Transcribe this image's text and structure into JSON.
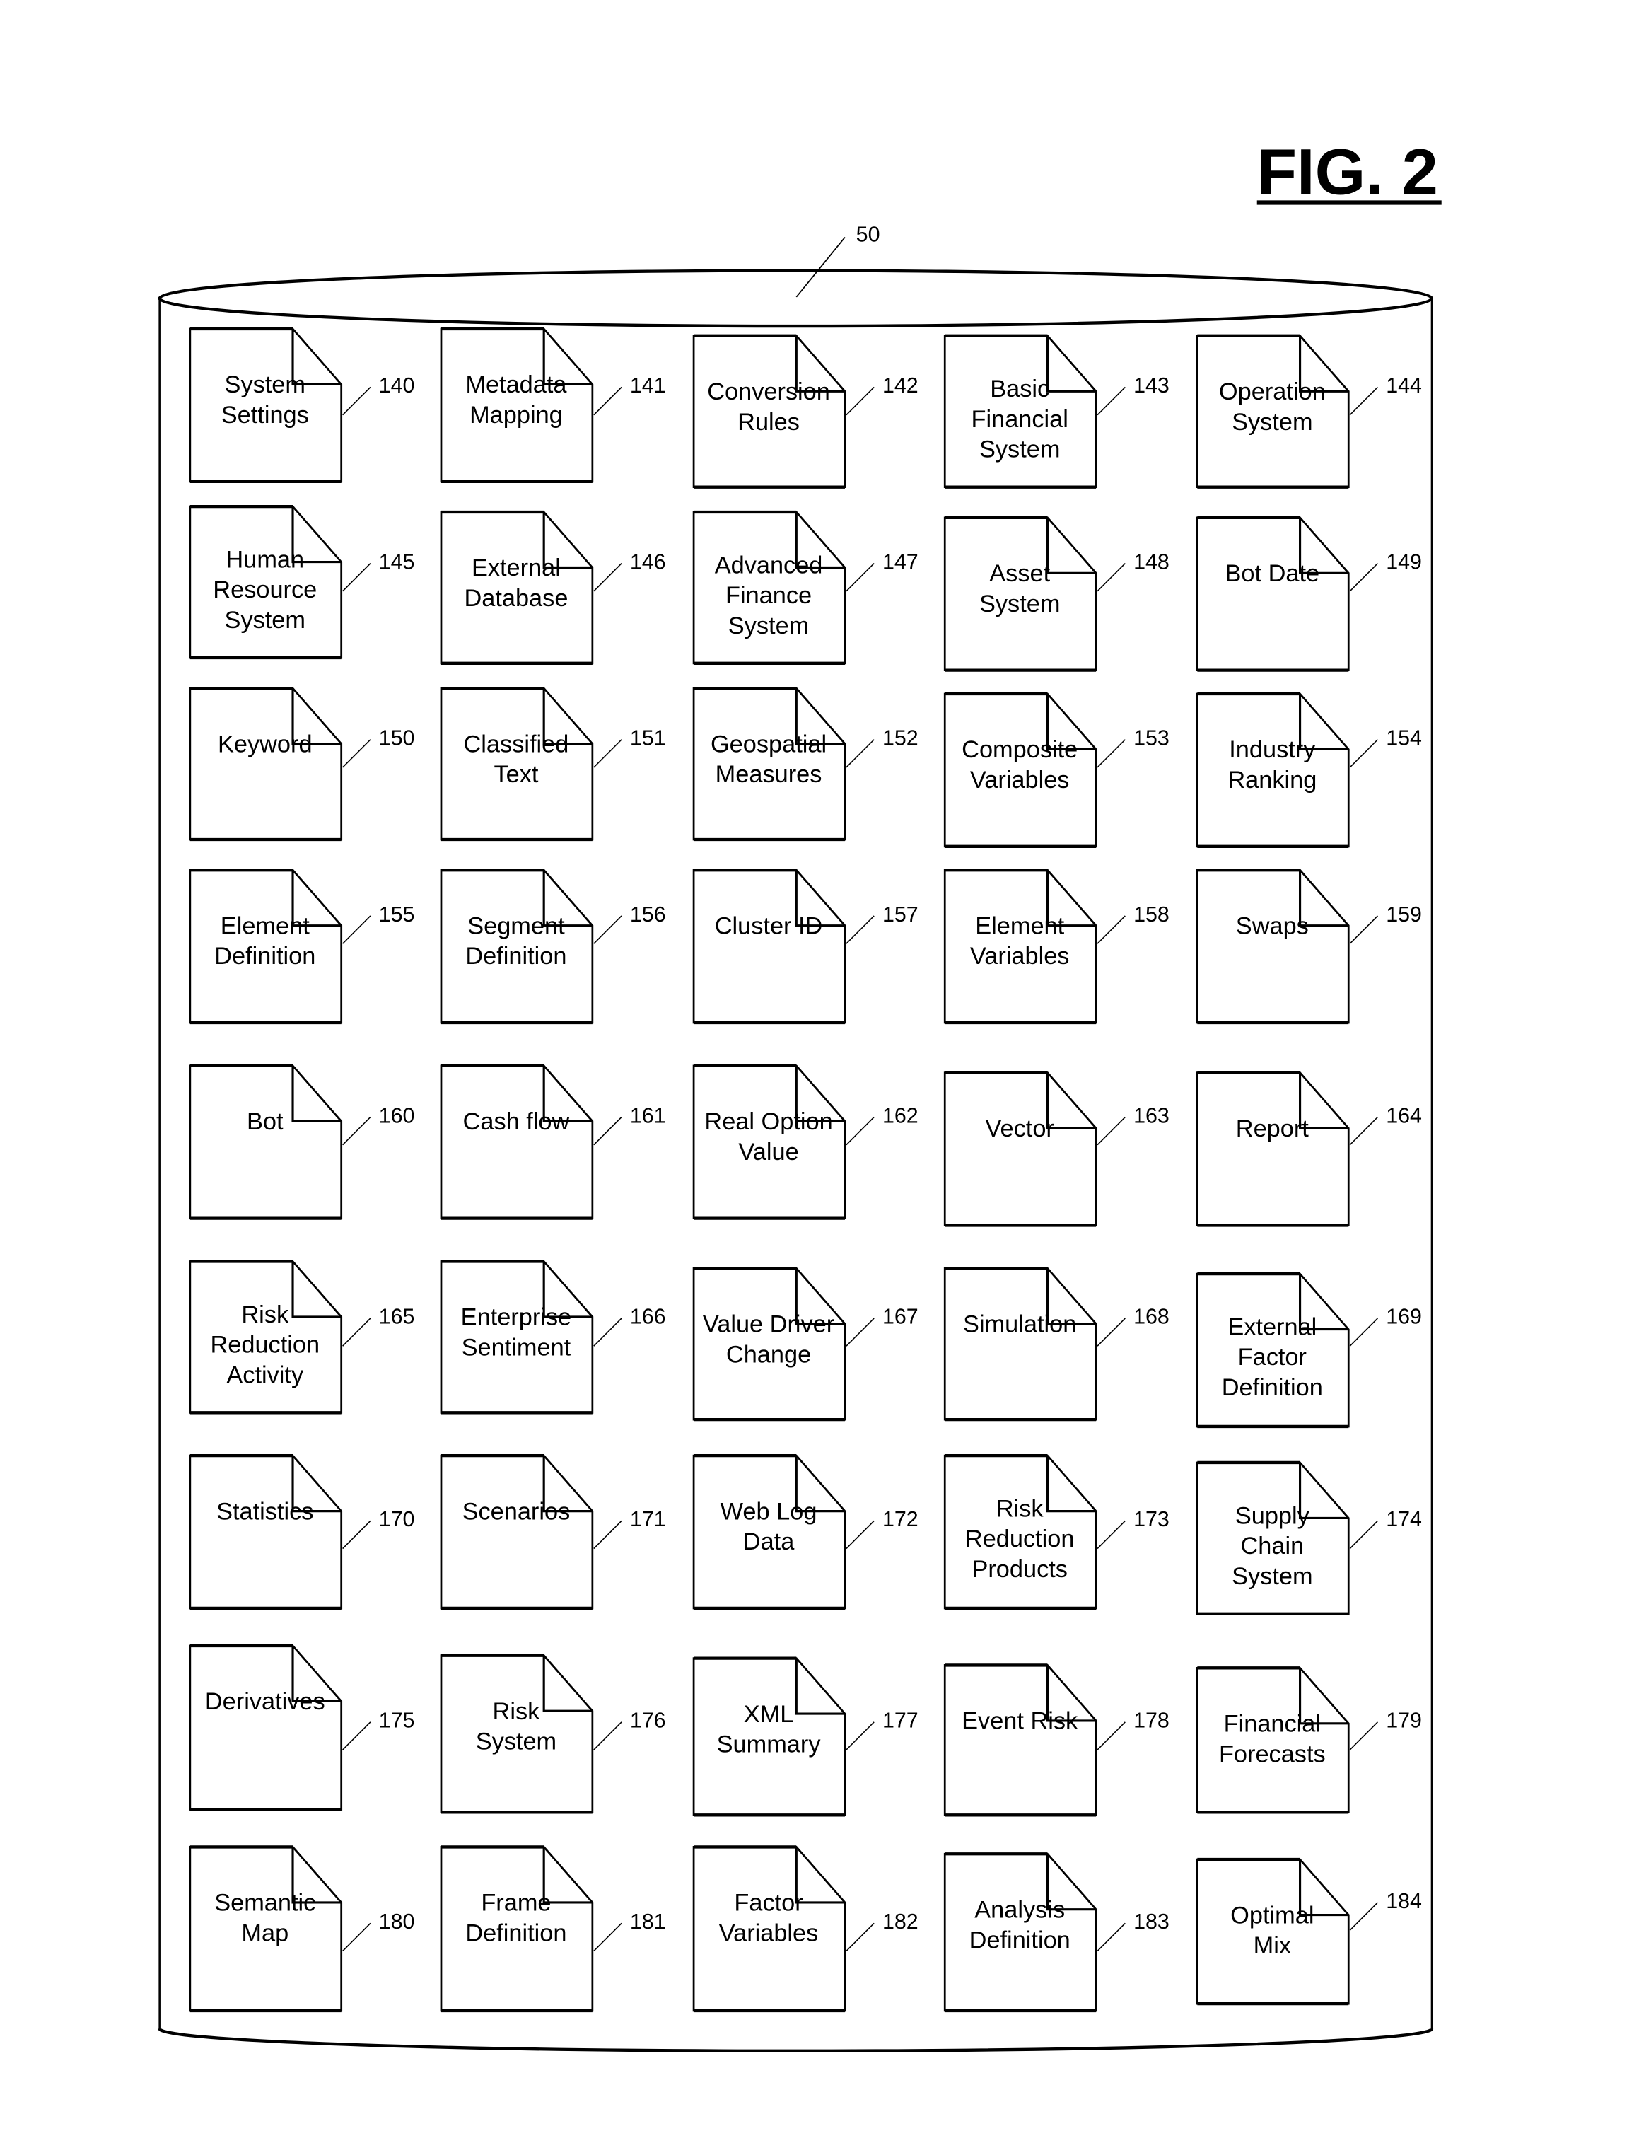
{
  "figure": {
    "title": "FIG. 2",
    "database_ref": "50"
  },
  "documents": [
    {
      "ref": "140",
      "label": [
        "System",
        "Settings"
      ]
    },
    {
      "ref": "141",
      "label": [
        "Metadata",
        "Mapping"
      ]
    },
    {
      "ref": "142",
      "label": [
        "Conversion",
        "Rules"
      ]
    },
    {
      "ref": "143",
      "label": [
        "Basic",
        "Financial",
        "System"
      ]
    },
    {
      "ref": "144",
      "label": [
        "Operation",
        "System"
      ]
    },
    {
      "ref": "145",
      "label": [
        "Human",
        "Resource",
        "System"
      ]
    },
    {
      "ref": "146",
      "label": [
        "External",
        "Database"
      ]
    },
    {
      "ref": "147",
      "label": [
        "Advanced",
        "Finance",
        "System"
      ]
    },
    {
      "ref": "148",
      "label": [
        "Asset",
        "System"
      ]
    },
    {
      "ref": "149",
      "label": [
        "Bot Date"
      ]
    },
    {
      "ref": "150",
      "label": [
        "Keyword"
      ]
    },
    {
      "ref": "151",
      "label": [
        "Classified",
        "Text"
      ]
    },
    {
      "ref": "152",
      "label": [
        "Geospatial",
        "Measures"
      ]
    },
    {
      "ref": "153",
      "label": [
        "Composite",
        "Variables"
      ]
    },
    {
      "ref": "154",
      "label": [
        "Industry",
        "Ranking"
      ]
    },
    {
      "ref": "155",
      "label": [
        "Element",
        "Definition"
      ]
    },
    {
      "ref": "156",
      "label": [
        "Segment",
        "Definition"
      ]
    },
    {
      "ref": "157",
      "label": [
        "Cluster ID"
      ]
    },
    {
      "ref": "158",
      "label": [
        "Element",
        "Variables"
      ]
    },
    {
      "ref": "159",
      "label": [
        "Swaps"
      ]
    },
    {
      "ref": "160",
      "label": [
        "Bot"
      ]
    },
    {
      "ref": "161",
      "label": [
        "Cash flow"
      ]
    },
    {
      "ref": "162",
      "label": [
        "Real Option",
        "Value"
      ]
    },
    {
      "ref": "163",
      "label": [
        "Vector"
      ]
    },
    {
      "ref": "164",
      "label": [
        "Report"
      ]
    },
    {
      "ref": "165",
      "label": [
        "Risk",
        "Reduction",
        "Activity"
      ]
    },
    {
      "ref": "166",
      "label": [
        "Enterprise",
        "Sentiment"
      ]
    },
    {
      "ref": "167",
      "label": [
        "Value Driver",
        "Change"
      ]
    },
    {
      "ref": "168",
      "label": [
        "Simulation"
      ]
    },
    {
      "ref": "169",
      "label": [
        "External",
        "Factor",
        "Definition"
      ]
    },
    {
      "ref": "170",
      "label": [
        "Statistics"
      ]
    },
    {
      "ref": "171",
      "label": [
        "Scenarios"
      ]
    },
    {
      "ref": "172",
      "label": [
        "Web Log",
        "Data"
      ]
    },
    {
      "ref": "173",
      "label": [
        "Risk",
        "Reduction",
        "Products"
      ]
    },
    {
      "ref": "174",
      "label": [
        "Supply",
        "Chain",
        "System"
      ]
    },
    {
      "ref": "175",
      "label": [
        "Derivatives"
      ]
    },
    {
      "ref": "176",
      "label": [
        "Risk",
        "System"
      ]
    },
    {
      "ref": "177",
      "label": [
        "XML",
        "Summary"
      ]
    },
    {
      "ref": "178",
      "label": [
        "Event Risk"
      ]
    },
    {
      "ref": "179",
      "label": [
        "Financial",
        "Forecasts"
      ]
    },
    {
      "ref": "180",
      "label": [
        "Semantic",
        "Map"
      ]
    },
    {
      "ref": "181",
      "label": [
        "Frame",
        "Definition"
      ]
    },
    {
      "ref": "182",
      "label": [
        "Factor",
        "Variables"
      ]
    },
    {
      "ref": "183",
      "label": [
        "Analysis",
        "Definition"
      ]
    },
    {
      "ref": "184",
      "label": [
        "Optimal",
        "Mix"
      ]
    }
  ]
}
